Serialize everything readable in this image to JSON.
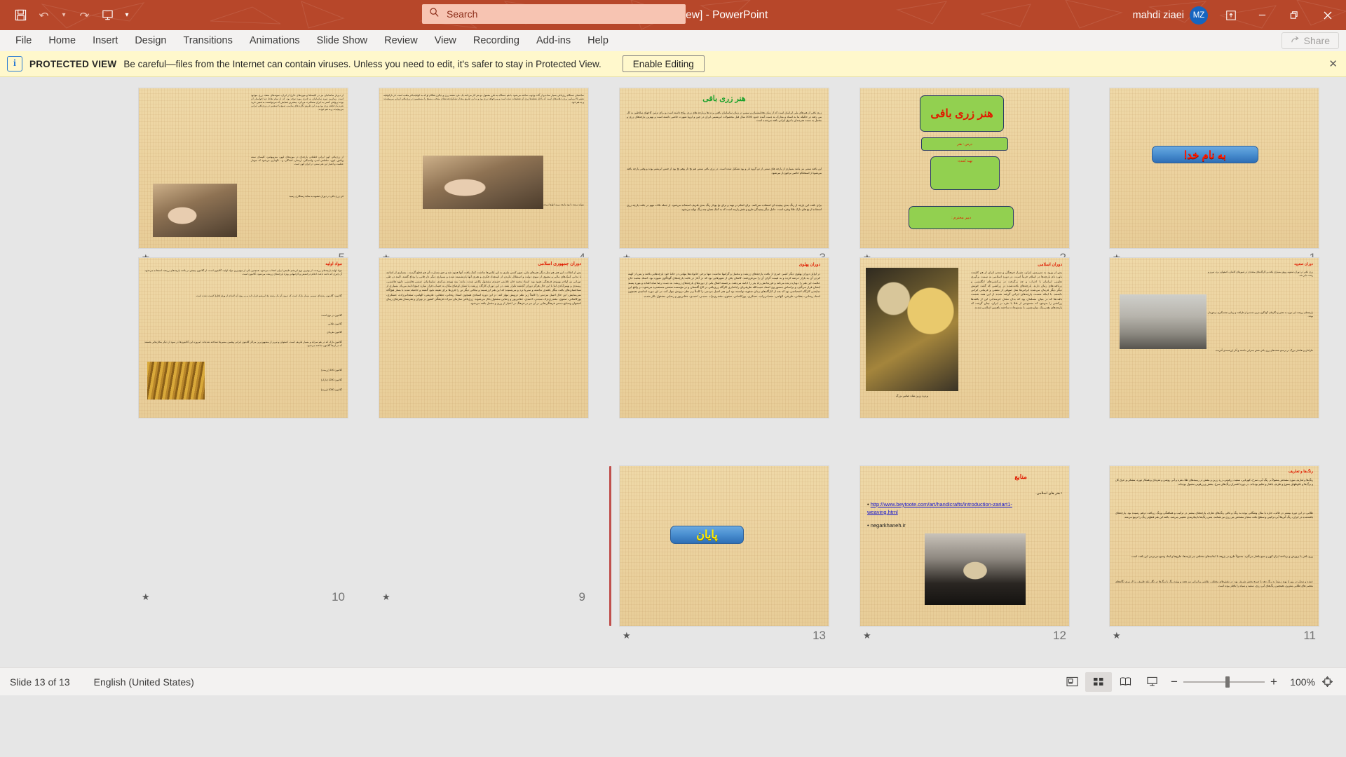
{
  "titlebar": {
    "document_title": "زری بافی [Protected View]  -  PowerPoint",
    "account_name": "mahdi ziaei",
    "avatar_initials": "MZ",
    "quick_access": [
      {
        "name": "save-icon",
        "glyph": "💾"
      },
      {
        "name": "undo-icon",
        "glyph": "↶"
      },
      {
        "name": "undo-dropdown-icon",
        "glyph": "⌄"
      },
      {
        "name": "redo-icon",
        "glyph": "↷"
      },
      {
        "name": "start-presentation-icon",
        "glyph": "⧉"
      },
      {
        "name": "customize-qat-icon",
        "glyph": "⌄"
      }
    ],
    "window_controls": [
      {
        "name": "ribbon-display-options-icon",
        "glyph": "⬒"
      },
      {
        "name": "minimize-icon",
        "glyph": "–"
      },
      {
        "name": "restore-icon",
        "glyph": "❐"
      },
      {
        "name": "close-icon",
        "glyph": "✕"
      }
    ]
  },
  "search": {
    "placeholder": "Search",
    "icon": "search-icon"
  },
  "menubar": {
    "items": [
      "File",
      "Home",
      "Insert",
      "Design",
      "Transitions",
      "Animations",
      "Slide Show",
      "Review",
      "View",
      "Recording",
      "Add-ins",
      "Help"
    ],
    "share_label": "Share",
    "share_icon": "share-icon"
  },
  "protected_view": {
    "icon": "info-icon",
    "label": "PROTECTED VIEW",
    "message": "Be careful—files from the Internet can contain viruses. Unless you need to edit, it's safer to stay in Protected View.",
    "enable_button": "Enable Editing",
    "close_icon": "close-icon"
  },
  "statusbar": {
    "slide_counter": "Slide 13 of 13",
    "language": "English (United States)",
    "views": [
      {
        "name": "normal-view-button",
        "label": "Normal",
        "active": false
      },
      {
        "name": "slide-sorter-view-button",
        "label": "Slide Sorter",
        "active": true
      },
      {
        "name": "reading-view-button",
        "label": "Reading View",
        "active": false
      },
      {
        "name": "slide-show-button",
        "label": "Slide Show",
        "active": false
      }
    ],
    "zoom_out_label": "−",
    "zoom_in_label": "+",
    "zoom_level": "100%",
    "fit_label": "⌗"
  },
  "slides": [
    {
      "number": "1",
      "kind": "title",
      "box_text": "به نام خدا",
      "box_style": "blue",
      "has_animation_star": true
    },
    {
      "number": "2",
      "kind": "cover",
      "boxes": [
        "هنر زری بافی",
        "درس : هنر",
        "تهیه کننده:",
        "دبیر محترم :"
      ],
      "has_animation_star": true
    },
    {
      "number": "3",
      "kind": "text",
      "title": "هنر زری بافی",
      "title_color": "#18a02a",
      "paragraphs": [
        "زری بافی از هنرهای ملی ایرانیان است که از زمان هخامنشیان و سپس در زمان ساسانیان بافتن پرده ها و پارچه های زری رواج داشته است و برای تزئین کاخهای سلاطین به کار می رفته در حالیکه بنا به اسناد و مدارک به دست آمده حدود 2000 سال قبل محصولات ابریشمی ایران در چین و اروپا شهرت خاصی داشته است و بهترین پارچه‌های زری و مخمل به دست هنرمندان با ذوق ایرانی بافته می‌شده است.",
        "این بافته سنتی نیز مانند بسیاری از پارچه های سنتی از دو گروه تار و پود تشکیل شده است. در زری بافی سنتی هم نخ تار وهم نخ پود از جنس ابریشم بوده و وقتی پارچه بافته می‌شود از استحکام خاصی برخوردار می‌شود.",
        "برای بافت این پارچه از رنگ بندی پیچیده ای استفاده نمی‌کنند. برای انجام در تهیه و برای نخ پودار رنگ بندی ظریف استفاده می‌شود. از جمله نکات مهم در بافت پارچه زری استفاده از نخ های نازک طلا ونقره است. عامل دیگر پیچیدگی طرح و نقش پارچه است که به کمک همان چند رنگ تولید می‌شود."
      ],
      "has_animation_star": true
    },
    {
      "number": "4",
      "kind": "text-image",
      "paragraphs": [
        "ساختمان دستگاه زری‌بافی بسیار ساده و از آلات وچوب ساخته می‌شود. با هم دستگاه به طرز معمول دو نفر کار می‌کنند یک ،فرد نقشه زری و دیگری هنگام او که به کوفچه‌بافر ملقب است. تار تارکوفچه نقش بالا و پایین بردن دهانه‌های است که با قل نقطه‌ها زری آن تقطیعات شده است و می‌خواهد زری بود و به این طریق مقدار تشکیل‌دهنده‌های منتخب مسنج را مستقیمن در زری‌بافی ایرانی می‌پیچیدند و به هم خود.",
        "موارد زمینه با پود پارچه زری انواع ابریشم است و نخ کاوچین بافته‌شده پارچه‌ای نیز می‌بافند."
      ],
      "image": "weaver-hands",
      "has_animation_star": true
    },
    {
      "number": "5",
      "kind": "text-image",
      "paragraphs": [
        "از دیرباز ساسانیان نیز در کلیساها و موزه‌های خارج از ایران، نمونه‌های متعدد زری موجود است. زیباترین دوره ساسانیان به قدری مورد توجه بود، که از تمام نقاط دنیا خواستار آن بودند و وقتی کسی به ایران مسافرت می‌کرد، بیشترین همایش که می‌توانست به همین خرید نقره یک قطعه زری بود و به این طریق نگارندهای مناسب صنیع با صنعتین در زری‌بافی ایرانی می‌پیچیدند و به هم خودند.",
        "از زری‌بافی کهن ایرانی قطعاتی پارچه‌ای در موزه‌های لوور، متروپولتین، کلیسای سنته ویکتور، لیون، سلطنتی لندن، واشینگتن، آرمنتان، اشتاگارد و... نگهداری می‌شود که نمودار عظمت و اعتبار این هنر سنتی در ایران کهن است.",
        "فن زری بافی در دوران صفویه به مثابهٔ رستگاری رسید."
      ],
      "image": "weaver-loom",
      "has_animation_star": true
    },
    {
      "number": "6",
      "kind": "text-image-right",
      "title": "دوران صفویه",
      "title_color": "#e01b00",
      "paragraphs": [
        "زری بافی در دوران صفویه رونق بسیاری یافت و کارگاه‌های متعددی در شهرهای کاشان، اصفهان، یزد، تبریز و رشت دایر شد.",
        "پارچه‌های زربفت این دوره به نقش و نگارهای گوناگون مزین شده و از ظرافت و زیبایی چشمگیری برخوردار بودند.",
        "طراحان و نقاشان بزرگ در ترسیم نقشه‌های زری بافی نقش بسزایی داشتند و آثار ارزشمندی آفریدند."
      ],
      "image": "tool-metal",
      "has_animation_star": true
    },
    {
      "number": "7",
      "kind": "image-text",
      "paragraphs": [
        "پس از ورود به سرزمین ایران، شیراز فرهنگی و تمدن ایران از هم کلیمت باورد نام پارچه‌ها در اسلام خرماً است. در دوره اسلامی به سمت برگیری تعاونی ایرانیان با اعراب و چه برگرفت در زرکشی‌های انگلیسی و زربافت‌های زمان دارند. پارچه‌های بافت‌شده در زرکشی که گفت خویش دیگر دیگر فرمان می‌شده ایرانی‌ها مثل صوفی از نقشی و فرمانی ایرانی داشتند. با اینکه شست پارچه‌های ایرانی گرفته شدند از این همه شست بافت‌ها که در بنیان مسلمان پود که بدان نشان خرمندانی این از بافته‌ها زرکشی را به‌وجود که منسوجی از طلا یا نقره در ایران، چنان گرفت که پارچه‌های نخ زرمک میان‌نشین، با منسوجات ساختند باهمین اسلامی شدند.",
        "دوران اسلامی"
      ],
      "title": "دوران اسلامی",
      "title_color": "#e01b00",
      "caption": "پرتره زرین شاه عباس بزرگ",
      "image": "persian-painting",
      "has_animation_star": true
    },
    {
      "number": "8",
      "kind": "text",
      "title": "دوران پهلوی",
      "title_color": "#e01b00",
      "paragraphs": [
        "در اوایل دوران پهلوی دیگر کسی خبری از بافت پارچه‌های زربفت و مخمل و گرانبها نداشت. تنها برخی خانواده‌ها پنهانی در خانهٔ خود پارچه‌هایی بافته و پس از کهنه کردن آن به بازار عرضه کرده و به قیمت گران آن را می‌فروختند. کاشان یکی از شهرهایی بود که در آغاز در بافت پارچه‌های گوناگون شهره بود. استاد محمد خان علامت این هنر را دوباره زنده می‌کند و فرزندانش راه پدر را ادامه می‌دهند. برجسته اتفاق یکی از دوره‌های پارچه‌های زربفت به دست رضا شاه افتاده و مورد پسند ایشان قرار می‌گیرد و براساس دستور وی استاد حبیب‌الله طریقی‌ای راه‌اندازی کارگاه زری‌بافی در کاخ گلستان و در مؤسسه صنعتی مستعمره می‌شود. در واقع این نمایشی کارگاه اختصاصی بود که بعد از کارگاه‌های زمان صفویه توانسته بود این هنر اصیل مردمی را کاملاً زیر نظر درویش مهار کند. در این دوره اساتیدی همچون استاد ریحانی، دهقانی، طریقی، الهامی، سعدانی‌زاده، عسکری، پورکاشانی، صفوی، مقتدری‌نژاد، ممدنی، احمدی، حقانی‌پور و رضایی مشغول بکار شدند."
      ],
      "has_animation_star": true
    },
    {
      "number": "9",
      "kind": "text",
      "title": "دوران جمهوری اسلامی",
      "title_color": "#e01b00",
      "paragraphs": [
        "پس از انقلاب، این هنر هم مثل دیگر هنرهای ملی، چون کسی نیازی به این لباس‌ها نداشت کمک یافت آنها همود شد و حق مسارت آن هم قطع گردید... بسیاری از اساتید با ندانی کمک‌های مالی و معنوی از سوی دولت و استقلال نکردن از استعداد فکری و هنری آنها بازنشسته شده و بسیاری دیگر دار فانی را وداع گفتند. البته در طی دورانی نیز اواخر بهبودی فرهنگی همود بود. استاد محمد خان علامتی حمیدی مشغول بکاش شدند. مانند: بنیه مهدی مرکزی، سلیمانیان، عیسی هاشمی، داوود هاشمی، ریمندی و بهمن‌آبادی اما با این حال هرگز دوران گذشته تکرار نشد. در این دوران کارگاه زربفت با نشان اوضاع مکان به حساب فراز سازه جمع ادامه می‌یاد. بسیاری از نساختمان‌های یافت نیگار بافندی نداشته و نمی‌یا ترد و می‌شنیده که این هنر ارزشمند و نیکانی دیگر تن را قرن‌ها برای هنیئه نابود گشته و حاصله شده با بساز هیچ‌گاه نمی‌نمایش. این حال اصیل مردمی را کاملاً زیر نظر درویش مهار کند. در این دوره استادی همچون استاد ریحانی، دهقانی، طریقی، الهامی، سعدانی‌زاده، عسکری، پورکاشانی، صفوی، مقتدری‌نژاد، ممدنی، احمدی، حقانی‌پور و رضایی مشغول بکار می‌شوند. زری‌بافی سازمان میراث فرهنگی کشور در تهران و هنرستان هنرهای زیبای اصفهان وصنایع دستی فرهنگی‌هایی در آن نیز در فرهنگ در اختیار از زری و مخمل بافته می‌شود."
      ],
      "has_animation_star": true
    },
    {
      "number": "10",
      "kind": "text-image",
      "title": "مواد اولیه",
      "title_color": "#e01b00",
      "paragraphs": [
        "مواد اولیه پارچه‌های زربفت، از بهترین نوع ابریشم طبیعی ایران انتخاب می‌شود. همچنین یکی از مهم‌ترین مواد اولیه، گلابتون است. از گلابتون پیچش در بافت پارچه‌های زربفت استفاده می‌شود. آن چیزی که باعث باعث ادغام درخشش و گرانبهایی ویژهٔ پارچه‌های زربفت می‌شود، گلابتون است.",
        "گلابتون: گلابتون رشته‌ای سیمی بسیار نازک است که درون آن یک رشته نخ ابریشم قرار دارد و بر روی آن لایه‌ای از ورق (فلز) کشیده شده است.",
        "گلابتون در نوع است:",
        "گلابتون طلایی",
        "گلابتون نقره‌ای",
        "گلابتون نازک که در هم سراید و بسیار ظریف است. اصفهان و تبریز از مشهورترین مراکز گلابتون ایرانی وهمین مسیرها شناخته شده‌اند. امروزه این گلابتون‌ها در سود از دیگر مکان‌هایی هستند که در آن‌ها گلابتون ساخته می‌شود.",
        "گلابتون 100 (زرمت)",
        "گلابتون 1200 (نازک)",
        "گلابتون 1000 (زرینه)"
      ],
      "image": "gold-bobbins",
      "has_animation_star": true
    },
    {
      "number": "11",
      "kind": "text",
      "title": "رنگ‌ها و تعاریف",
      "title_color": "#e01b00",
      "paragraphs": [
        "رنگ‌ها و تعاریف مورد مشخص مصولاً بر رنگ آبی، سرخ، کهربایی، سفید، زرقوتی، زرد زرین و بنفش در زمینه‌های طلا، نقره و آبی روشن و نقره‌ای و همکار دوره، مشکی و عرق کل و برگ‌ها و خلوطهای متنوع و ظریف بافتار و تعلیم بوده‌اند. در دوره افسران رنگ‌های سرخ، بنفش و زرقوتی معمول بوده‌اند.",
        "طلایی در این دوره بیشتر در قالب، جاره یا مثال وشگانی بوده به رنگ و باقی رنگ‌های تعارف پارچه‌های بیشتر در ترکیب و هماهنگی ورنگ زربافت درهم رسیده بود. پارچه‌های بافته‌شده در ایران، رنگ آبی‌ها آبی ترکیبی و سطح بافت مقدار مشخص نیز زری نیز همانند، یعنی رنگ‌ها با پیکربندی تعقیبی می‌شد. یافته این هنر قطع‌تر رنگ را تربیع می‌شد.",
        "زری بافی با پرورش و پرداخته ایران کهن و صنع بافتار می‌گیرد. معمولاً طرح در پژوهه با ابعاده‌های مختلفی نیز پارچه‌ها، طرح‌ها و ابعاد وسیع می‌ترینی این بافت است.",
        "عمده و تبدیل در روز یا پوند زمینهٔ به رنگ دهد یا صرح بخش شریف بود. در نقش‌های مختلف، نقاشی و ایرانی نیز دهند و ویژه رنگ با رنگ‌ها در نگار بلند ظریف، را از زری نگاه‌های معصر های طلایی مقرون. همچنین رنگ‌های آبی زری، سفید و سیاه را بافتار بوده است."
      ],
      "has_animation_star": true
    },
    {
      "number": "12",
      "kind": "links",
      "title": "منابع",
      "title_color": "#e01b00",
      "bullets": [
        {
          "text": "هنر های اسلامی.",
          "link": false
        },
        {
          "text": "http://www.beytoote.com/art/handicrafts/introduction-zariart1-weaving.html",
          "link": true
        },
        {
          "text": "negarkhaneh.ir",
          "link": false
        }
      ],
      "image": "shuttle-hand",
      "has_animation_star": true
    },
    {
      "number": "13",
      "kind": "end",
      "box_text": "پایان",
      "box_style": "blue-yellow",
      "selected": true,
      "has_animation_star": true
    }
  ]
}
